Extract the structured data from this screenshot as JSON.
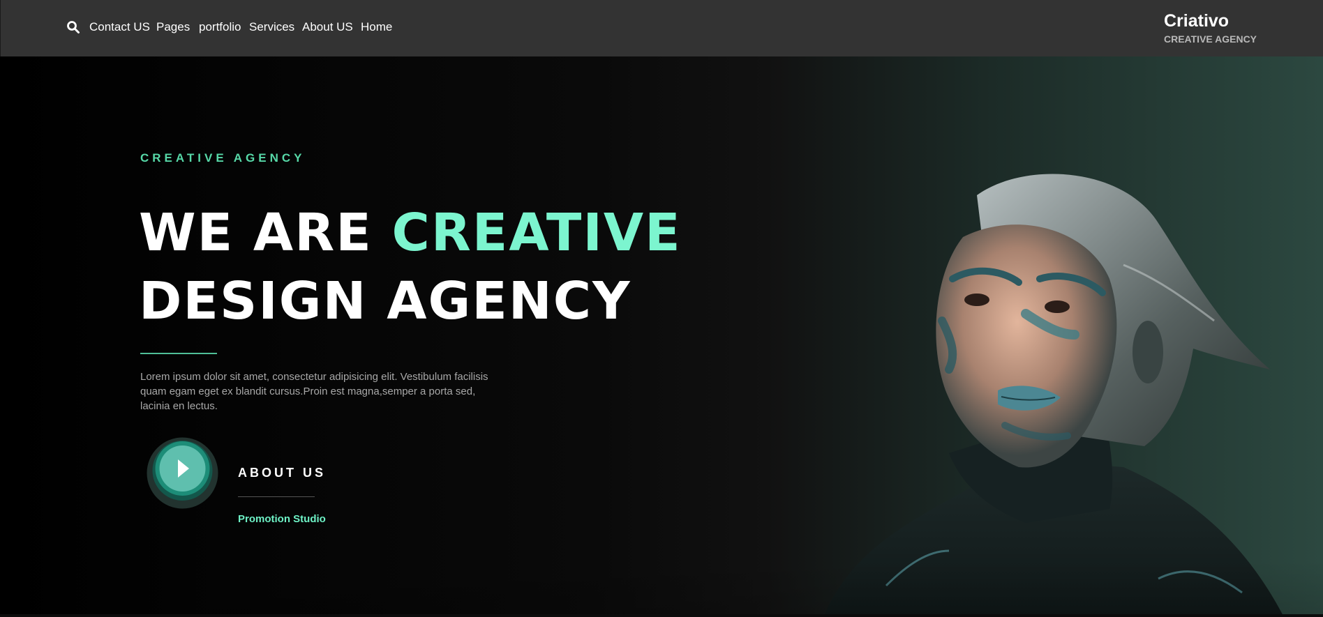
{
  "nav": {
    "search_icon": "search-icon",
    "links": [
      "Contact US",
      "Pages",
      "portfolio",
      "Services",
      "About US",
      "Home"
    ]
  },
  "brand": {
    "title": "Criativo",
    "subtitle": "CREATIVE AGENCY"
  },
  "hero": {
    "eyebrow": "CREATIVE AGENCY",
    "headline_line1_white": "WE ARE ",
    "headline_line1_accent": "CREATIVE",
    "headline_line2": "DESIGN AGENCY",
    "description": "Lorem ipsum dolor sit amet, consectetur adipisicing elit. Vestibulum facilisis quam egam eget ex blandit cursus.Proin est magna,semper a porta sed, lacinia en lectus.",
    "play_icon": "play-icon",
    "about_label": "ABOUT US",
    "promo": "Promotion Studio"
  },
  "colors": {
    "accent": "#7cf5cf",
    "accent_dark": "#57d9a8",
    "topbar": "#333333",
    "teal_play": "#1a9c82"
  }
}
